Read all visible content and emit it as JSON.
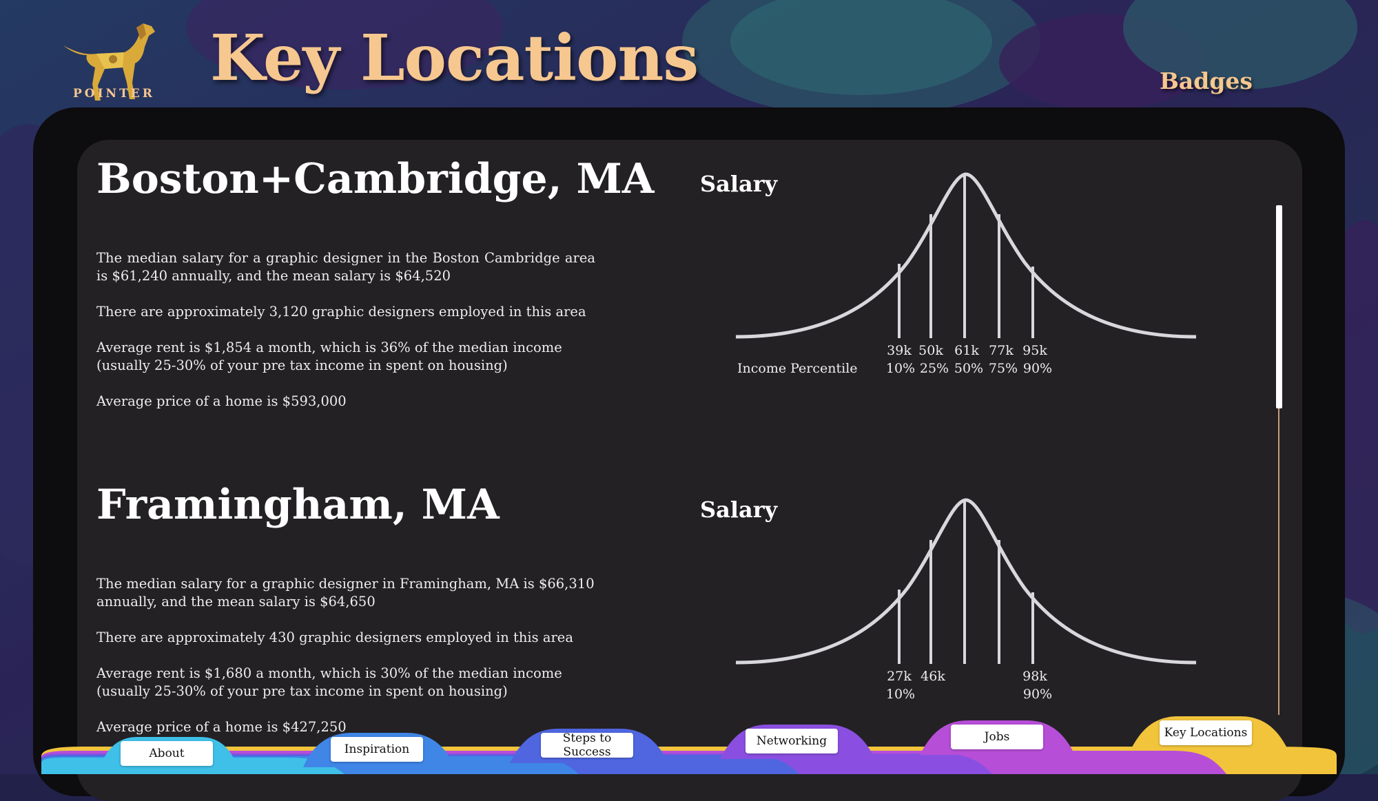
{
  "header": {
    "logo_text": "POINTER",
    "page_title": "Key Locations",
    "badges_label": "Badges"
  },
  "locations": [
    {
      "title": "Boston+Cambridge, MA",
      "paragraphs": [
        "The median salary for a graphic designer in the Boston Cambridge area is $61,240 annually, and the mean salary is $64,520",
        "There are approximately 3,120 graphic designers employed in this area",
        "Average rent is $1,854 a month,  which is 36% of the median income (usually 25-30% of your pre tax income in spent on housing)",
        "Average price of a home is $593,000"
      ],
      "salary_label": "Salary",
      "axis_label": "Income Percentile"
    },
    {
      "title": "Framingham, MA",
      "paragraphs": [
        "The median salary for a graphic designer in Framingham, MA is $66,310 annually, and the mean salary is $64,650",
        "There are approximately 430 graphic designers employed in this area",
        "Average rent is $1,680 a month,  which is 30% of the median income (usually 25-30% of your pre tax income in spent on housing)",
        "Average price of a home is $427,250"
      ],
      "salary_label": "Salary",
      "axis_label": ""
    }
  ],
  "chart_data": [
    {
      "type": "line",
      "title": "Salary",
      "xlabel": "Income Percentile",
      "percentiles": [
        "10%",
        "25%",
        "50%",
        "75%",
        "90%"
      ],
      "salaries": [
        "39k",
        "50k",
        "61k",
        "77k",
        "95k"
      ]
    },
    {
      "type": "line",
      "title": "Salary",
      "xlabel": "",
      "percentiles": [
        "10%",
        "",
        "",
        "",
        "90%"
      ],
      "salaries": [
        "27k",
        "46k",
        "",
        "",
        "98k"
      ]
    }
  ],
  "tabs": [
    {
      "label": "About",
      "color": "#3fc0e8"
    },
    {
      "label": "Inspiration",
      "color": "#3f86e6"
    },
    {
      "label": "Steps to Success",
      "color": "#4f66e0"
    },
    {
      "label": "Networking",
      "color": "#8a4fe0"
    },
    {
      "label": "Jobs",
      "color": "#b64ed8"
    },
    {
      "label": "Key Locations",
      "color": "#f2c43c"
    }
  ],
  "colors": {
    "title": "#f6c78f",
    "panel": "#232124",
    "frame": "#0d0c0e",
    "curve": "#d8d8dc"
  }
}
